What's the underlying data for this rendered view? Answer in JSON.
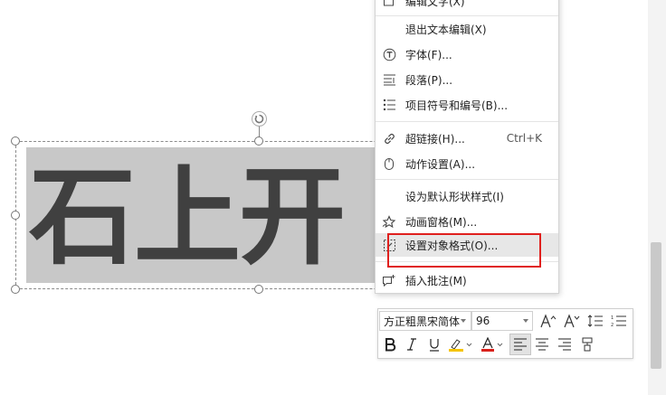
{
  "textbox": {
    "text": "石上开"
  },
  "context_menu": {
    "items": [
      {
        "label": "编辑文字(X)",
        "icon": "edit-text-icon",
        "partial": true
      },
      {
        "label": "退出文本编辑(X)"
      },
      {
        "label": "字体(F)...",
        "icon": "font-T-icon"
      },
      {
        "label": "段落(P)...",
        "icon": "paragraph-icon"
      },
      {
        "label": "项目符号和编号(B)...",
        "icon": "bullet-list-icon"
      },
      {
        "label": "超链接(H)...",
        "icon": "hyperlink-icon",
        "shortcut": "Ctrl+K"
      },
      {
        "label": "动作设置(A)...",
        "icon": "mouse-icon"
      },
      {
        "label": "设为默认形状样式(I)"
      },
      {
        "label": "动画窗格(M)...",
        "icon": "animation-star-icon"
      },
      {
        "label": "设置对象格式(O)...",
        "icon": "format-object-icon",
        "highlighted": true
      },
      {
        "label": "插入批注(M)",
        "icon": "comment-add-icon"
      }
    ]
  },
  "mini_toolbar": {
    "font_name": "方正粗黑宋简体",
    "font_size": "96",
    "underline_color": "#f5c400",
    "font_color": "#d9201b"
  }
}
